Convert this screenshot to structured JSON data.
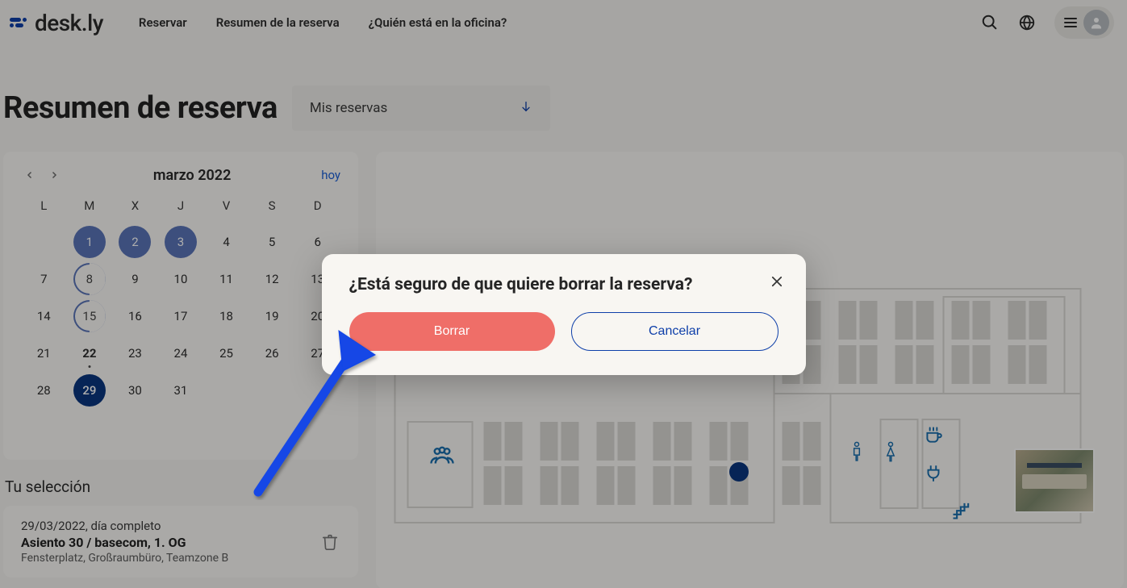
{
  "brand": {
    "name": "desk.ly"
  },
  "nav": {
    "reserve": "Reservar",
    "summary": "Resumen de la reserva",
    "who": "¿Quién está en la oficina?"
  },
  "page": {
    "title": "Resumen de reserva"
  },
  "filter": {
    "label": "Mis reservas"
  },
  "calendar": {
    "month_label": "marzo 2022",
    "today_label": "hoy",
    "dow": [
      "L",
      "M",
      "X",
      "J",
      "V",
      "S",
      "D"
    ],
    "weeks": [
      [
        {
          "n": ""
        },
        {
          "n": "1",
          "state": "booked"
        },
        {
          "n": "2",
          "state": "booked"
        },
        {
          "n": "3",
          "state": "booked"
        },
        {
          "n": "4"
        },
        {
          "n": "5"
        },
        {
          "n": "6"
        }
      ],
      [
        {
          "n": "7"
        },
        {
          "n": "8",
          "state": "partial"
        },
        {
          "n": "9"
        },
        {
          "n": "10"
        },
        {
          "n": "11"
        },
        {
          "n": "12"
        },
        {
          "n": "13"
        }
      ],
      [
        {
          "n": "14"
        },
        {
          "n": "15",
          "state": "partial"
        },
        {
          "n": "16"
        },
        {
          "n": "17"
        },
        {
          "n": "18"
        },
        {
          "n": "19"
        },
        {
          "n": "20"
        }
      ],
      [
        {
          "n": "21"
        },
        {
          "n": "22",
          "state": "today"
        },
        {
          "n": "23"
        },
        {
          "n": "24"
        },
        {
          "n": "25"
        },
        {
          "n": "26"
        },
        {
          "n": "27"
        }
      ],
      [
        {
          "n": "28"
        },
        {
          "n": "29",
          "state": "selected"
        },
        {
          "n": "30"
        },
        {
          "n": "31"
        },
        {
          "n": ""
        },
        {
          "n": ""
        },
        {
          "n": ""
        }
      ]
    ]
  },
  "selection": {
    "heading": "Tu selección",
    "date_line": "29/03/2022, día completo",
    "title": "Asiento 30 / basecom, 1. OG",
    "subtitle": "Fensterplatz, Großraumbüro, Teamzone B"
  },
  "dialog": {
    "title": "¿Está seguro de que quiere borrar la reserva?",
    "delete": "Borrar",
    "cancel": "Cancelar"
  }
}
